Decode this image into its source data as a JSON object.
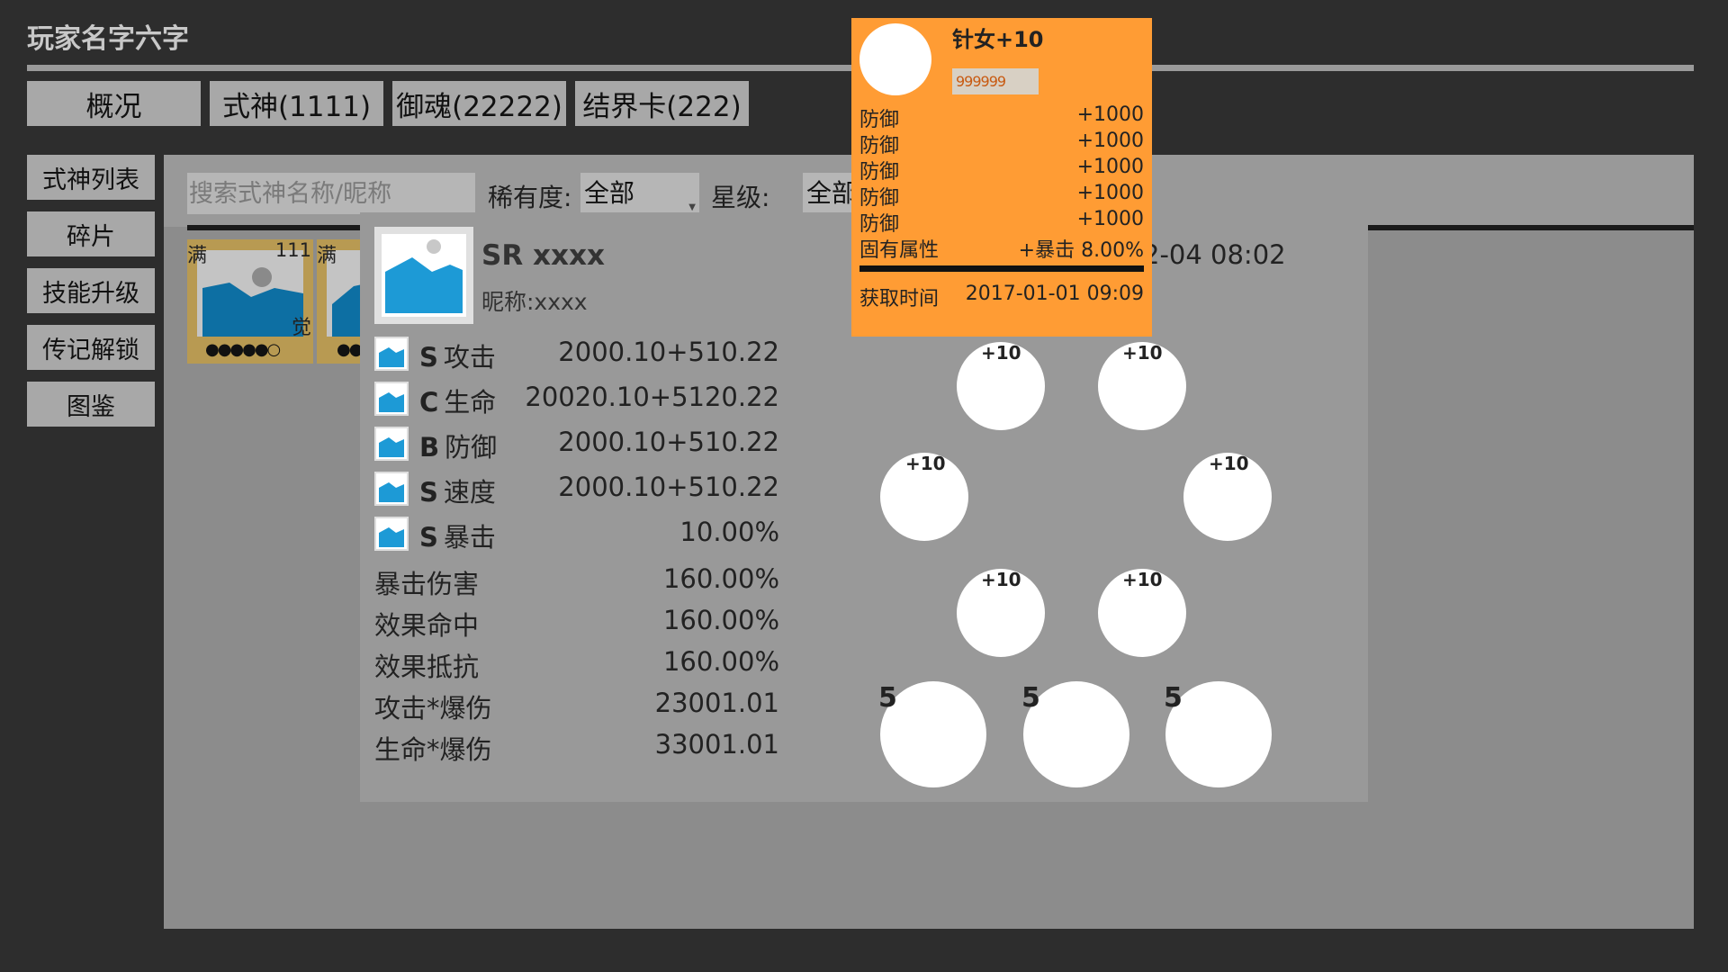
{
  "header": {
    "player_name": "玩家名字六字"
  },
  "tabs": [
    "概况",
    "式神(1111)",
    "御魂(22222)",
    "结界卡(222)"
  ],
  "sidebar": [
    "式神列表",
    "碎片",
    "技能升级",
    "传记解锁",
    "图鉴"
  ],
  "filter": {
    "search_placeholder": "搜索式神名称/昵称",
    "rarity_label": "稀有度:",
    "rarity_value": "全部",
    "star_label": "星级:",
    "star_value": "全部"
  },
  "cards": [
    {
      "full": "满",
      "level": "111",
      "awaken": "觉",
      "stars": "●●●●●○"
    },
    {
      "full": "满",
      "level": "",
      "awaken": "",
      "stars": "●●"
    }
  ],
  "detail": {
    "name": "SR xxxx",
    "nickname": "昵称:xxxx",
    "acquired_time_partial": "2-04 08:02",
    "stats": [
      {
        "grade": "S",
        "label": "攻击",
        "value": "2000.10+510.22"
      },
      {
        "grade": "C",
        "label": "生命",
        "value": "20020.10+5120.22"
      },
      {
        "grade": "B",
        "label": "防御",
        "value": "2000.10+510.22"
      },
      {
        "grade": "S",
        "label": "速度",
        "value": "2000.10+510.22"
      },
      {
        "grade": "S",
        "label": "暴击",
        "value": "10.00%"
      }
    ],
    "extra_stats": [
      {
        "label": "暴击伤害",
        "value": "160.00%"
      },
      {
        "label": "效果命中",
        "value": "160.00%"
      },
      {
        "label": "效果抵抗",
        "value": "160.00%"
      },
      {
        "label": "攻击*爆伤",
        "value": "23001.01"
      },
      {
        "label": "生命*爆伤",
        "value": "33001.01"
      }
    ],
    "mitama_slots": [
      "+10",
      "+10",
      "+10",
      "+10",
      "+10",
      "+10"
    ],
    "skills": [
      "5",
      "5",
      "5"
    ]
  },
  "tooltip": {
    "name": "针女+10",
    "stars": "999999",
    "rows": [
      {
        "label": "防御",
        "value": "+1000"
      },
      {
        "label": "防御",
        "value": "+1000"
      },
      {
        "label": "防御",
        "value": "+1000"
      },
      {
        "label": "防御",
        "value": "+1000"
      },
      {
        "label": "防御",
        "value": "+1000"
      },
      {
        "label": "固有属性",
        "value": "+暴击 8.00%"
      }
    ],
    "acquired_label": "获取时间",
    "acquired_value": "2017-01-01 09:09"
  },
  "colors": {
    "background": "#2d2d2d",
    "tooltip": "#ff9c34",
    "card_frame": "#b89a52",
    "picture_blue": "#1d9ad6"
  }
}
